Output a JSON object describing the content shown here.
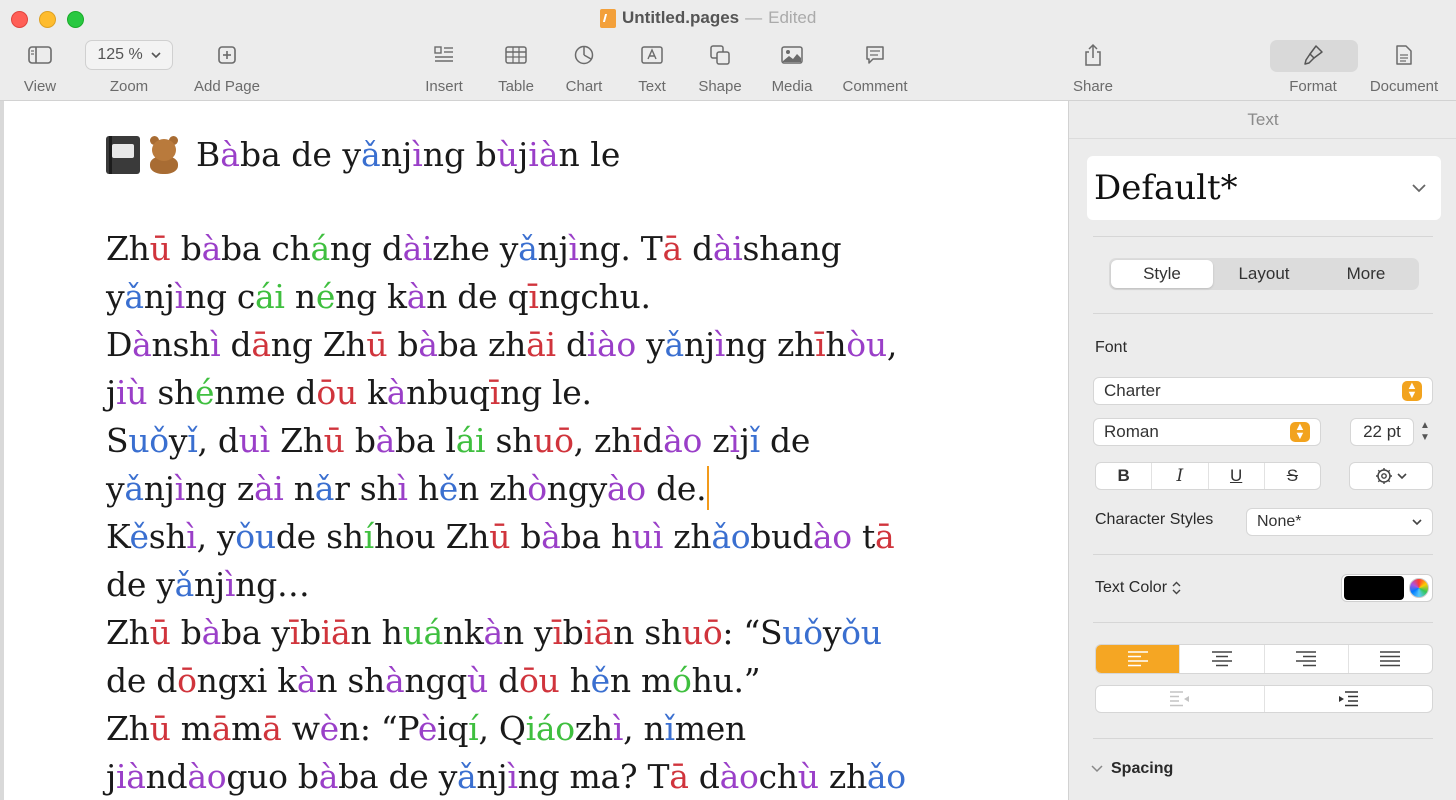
{
  "window": {
    "file_name": "Untitled.pages",
    "separator": "—",
    "status": "Edited"
  },
  "toolbar": {
    "view": "View",
    "zoom_value": "125 %",
    "zoom": "Zoom",
    "add_page": "Add Page",
    "insert": "Insert",
    "table": "Table",
    "chart": "Chart",
    "text": "Text",
    "shape": "Shape",
    "media": "Media",
    "comment": "Comment",
    "share": "Share",
    "format": "Format",
    "document": "Document"
  },
  "document": {
    "heading": [
      {
        "t": "B"
      },
      {
        "t": "à",
        "c": "p"
      },
      {
        "t": "ba de y"
      },
      {
        "t": "ǎ",
        "c": "b"
      },
      {
        "t": "nj"
      },
      {
        "t": "ì",
        "c": "p"
      },
      {
        "t": "ng b"
      },
      {
        "t": "ù",
        "c": "p"
      },
      {
        "t": "j"
      },
      {
        "t": "ià",
        "c": "p"
      },
      {
        "t": "n le"
      }
    ],
    "lines": [
      [
        {
          "t": "Zh"
        },
        {
          "t": "ū",
          "c": "r"
        },
        {
          "t": " b"
        },
        {
          "t": "à",
          "c": "p"
        },
        {
          "t": "ba ch"
        },
        {
          "t": "á",
          "c": "g"
        },
        {
          "t": "ng d"
        },
        {
          "t": "ài",
          "c": "p"
        },
        {
          "t": "zhe y"
        },
        {
          "t": "ǎ",
          "c": "b"
        },
        {
          "t": "nj"
        },
        {
          "t": "ì",
          "c": "p"
        },
        {
          "t": "ng. T"
        },
        {
          "t": "ā",
          "c": "r"
        },
        {
          "t": " d"
        },
        {
          "t": "ài",
          "c": "p"
        },
        {
          "t": "shang"
        }
      ],
      [
        {
          "t": "y"
        },
        {
          "t": "ǎ",
          "c": "b"
        },
        {
          "t": "nj"
        },
        {
          "t": "ì",
          "c": "p"
        },
        {
          "t": "ng c"
        },
        {
          "t": "ái",
          "c": "g"
        },
        {
          "t": " n"
        },
        {
          "t": "é",
          "c": "g"
        },
        {
          "t": "ng k"
        },
        {
          "t": "à",
          "c": "p"
        },
        {
          "t": "n de q"
        },
        {
          "t": "ī",
          "c": "r"
        },
        {
          "t": "ngchu."
        }
      ],
      [
        {
          "t": "D"
        },
        {
          "t": "à",
          "c": "p"
        },
        {
          "t": "nsh"
        },
        {
          "t": "ì",
          "c": "p"
        },
        {
          "t": " d"
        },
        {
          "t": "ā",
          "c": "r"
        },
        {
          "t": "ng Zh"
        },
        {
          "t": "ū",
          "c": "r"
        },
        {
          "t": " b"
        },
        {
          "t": "à",
          "c": "p"
        },
        {
          "t": "ba zh"
        },
        {
          "t": "āi",
          "c": "r"
        },
        {
          "t": " d"
        },
        {
          "t": "iào",
          "c": "p"
        },
        {
          "t": " y"
        },
        {
          "t": "ǎ",
          "c": "b"
        },
        {
          "t": "nj"
        },
        {
          "t": "ì",
          "c": "p"
        },
        {
          "t": "ng zh"
        },
        {
          "t": "ī",
          "c": "r"
        },
        {
          "t": "h"
        },
        {
          "t": "òu",
          "c": "p"
        },
        {
          "t": ","
        }
      ],
      [
        {
          "t": "j"
        },
        {
          "t": "iù",
          "c": "p"
        },
        {
          "t": " sh"
        },
        {
          "t": "é",
          "c": "g"
        },
        {
          "t": "nme d"
        },
        {
          "t": "ōu",
          "c": "r"
        },
        {
          "t": " k"
        },
        {
          "t": "à",
          "c": "p"
        },
        {
          "t": "nbuq"
        },
        {
          "t": "ī",
          "c": "r"
        },
        {
          "t": "ng le."
        }
      ],
      [
        {
          "t": "S"
        },
        {
          "t": "uǒ",
          "c": "b"
        },
        {
          "t": "y"
        },
        {
          "t": "ǐ",
          "c": "b"
        },
        {
          "t": ", d"
        },
        {
          "t": "uì",
          "c": "p"
        },
        {
          "t": " Zh"
        },
        {
          "t": "ū",
          "c": "r"
        },
        {
          "t": " b"
        },
        {
          "t": "à",
          "c": "p"
        },
        {
          "t": "ba l"
        },
        {
          "t": "ái",
          "c": "g"
        },
        {
          "t": " sh"
        },
        {
          "t": "uō",
          "c": "r"
        },
        {
          "t": ", zh"
        },
        {
          "t": "ī",
          "c": "r"
        },
        {
          "t": "d"
        },
        {
          "t": "ào",
          "c": "p"
        },
        {
          "t": " z"
        },
        {
          "t": "ì",
          "c": "p"
        },
        {
          "t": "j"
        },
        {
          "t": "ǐ",
          "c": "b"
        },
        {
          "t": " de"
        }
      ],
      [
        {
          "t": "y"
        },
        {
          "t": "ǎ",
          "c": "b"
        },
        {
          "t": "nj"
        },
        {
          "t": "ì",
          "c": "p"
        },
        {
          "t": "ng z"
        },
        {
          "t": "ài",
          "c": "p"
        },
        {
          "t": " n"
        },
        {
          "t": "ǎ",
          "c": "b"
        },
        {
          "t": "r sh"
        },
        {
          "t": "ì",
          "c": "p"
        },
        {
          "t": " h"
        },
        {
          "t": "ě",
          "c": "b"
        },
        {
          "t": "n zh"
        },
        {
          "t": "ò",
          "c": "p"
        },
        {
          "t": "ngy"
        },
        {
          "t": "ào",
          "c": "p"
        },
        {
          "t": " de."
        }
      ],
      [
        {
          "t": "K"
        },
        {
          "t": "ě",
          "c": "b"
        },
        {
          "t": "sh"
        },
        {
          "t": "ì",
          "c": "p"
        },
        {
          "t": ", y"
        },
        {
          "t": "ǒu",
          "c": "b"
        },
        {
          "t": "de sh"
        },
        {
          "t": "í",
          "c": "g"
        },
        {
          "t": "hou Zh"
        },
        {
          "t": "ū",
          "c": "r"
        },
        {
          "t": " b"
        },
        {
          "t": "à",
          "c": "p"
        },
        {
          "t": "ba h"
        },
        {
          "t": "uì",
          "c": "p"
        },
        {
          "t": " zh"
        },
        {
          "t": "ǎo",
          "c": "b"
        },
        {
          "t": "bud"
        },
        {
          "t": "ào",
          "c": "p"
        },
        {
          "t": " t"
        },
        {
          "t": "ā",
          "c": "r"
        }
      ],
      [
        {
          "t": "de y"
        },
        {
          "t": "ǎ",
          "c": "b"
        },
        {
          "t": "nj"
        },
        {
          "t": "ì",
          "c": "p"
        },
        {
          "t": "ng…"
        }
      ],
      [
        {
          "t": "Zh"
        },
        {
          "t": "ū",
          "c": "r"
        },
        {
          "t": " b"
        },
        {
          "t": "à",
          "c": "p"
        },
        {
          "t": "ba y"
        },
        {
          "t": "ī",
          "c": "r"
        },
        {
          "t": "b"
        },
        {
          "t": "iā",
          "c": "r"
        },
        {
          "t": "n h"
        },
        {
          "t": "uá",
          "c": "g"
        },
        {
          "t": "nk"
        },
        {
          "t": "à",
          "c": "p"
        },
        {
          "t": "n y"
        },
        {
          "t": "ī",
          "c": "r"
        },
        {
          "t": "b"
        },
        {
          "t": "iā",
          "c": "r"
        },
        {
          "t": "n sh"
        },
        {
          "t": "uō",
          "c": "r"
        },
        {
          "t": ": “S"
        },
        {
          "t": "uǒ",
          "c": "b"
        },
        {
          "t": "y"
        },
        {
          "t": "ǒu",
          "c": "b"
        }
      ],
      [
        {
          "t": "de d"
        },
        {
          "t": "ō",
          "c": "r"
        },
        {
          "t": "ngxi k"
        },
        {
          "t": "à",
          "c": "p"
        },
        {
          "t": "n sh"
        },
        {
          "t": "à",
          "c": "p"
        },
        {
          "t": "ngq"
        },
        {
          "t": "ù",
          "c": "p"
        },
        {
          "t": " d"
        },
        {
          "t": "ōu",
          "c": "r"
        },
        {
          "t": " h"
        },
        {
          "t": "ě",
          "c": "b"
        },
        {
          "t": "n m"
        },
        {
          "t": "ó",
          "c": "g"
        },
        {
          "t": "hu.”"
        }
      ],
      [
        {
          "t": "Zh"
        },
        {
          "t": "ū",
          "c": "r"
        },
        {
          "t": " m"
        },
        {
          "t": "ā",
          "c": "r"
        },
        {
          "t": "m"
        },
        {
          "t": "ā",
          "c": "r"
        },
        {
          "t": " w"
        },
        {
          "t": "è",
          "c": "p"
        },
        {
          "t": "n: “P"
        },
        {
          "t": "è",
          "c": "p"
        },
        {
          "t": "iq"
        },
        {
          "t": "í",
          "c": "g"
        },
        {
          "t": ", Q"
        },
        {
          "t": "iáo",
          "c": "g"
        },
        {
          "t": "zh"
        },
        {
          "t": "ì",
          "c": "p"
        },
        {
          "t": ", n"
        },
        {
          "t": "ǐ",
          "c": "b"
        },
        {
          "t": "men"
        }
      ],
      [
        {
          "t": "j"
        },
        {
          "t": "ià",
          "c": "p"
        },
        {
          "t": "nd"
        },
        {
          "t": "ào",
          "c": "p"
        },
        {
          "t": "guo b"
        },
        {
          "t": "à",
          "c": "p"
        },
        {
          "t": "ba de y"
        },
        {
          "t": "ǎ",
          "c": "b"
        },
        {
          "t": "nj"
        },
        {
          "t": "ì",
          "c": "p"
        },
        {
          "t": "ng ma? T"
        },
        {
          "t": "ā",
          "c": "r"
        },
        {
          "t": " d"
        },
        {
          "t": "ào",
          "c": "p"
        },
        {
          "t": "ch"
        },
        {
          "t": "ù",
          "c": "p"
        },
        {
          "t": " zh"
        },
        {
          "t": "ǎo",
          "c": "b"
        }
      ]
    ]
  },
  "sidebar": {
    "header": "Text",
    "paragraph_style": "Default*",
    "tabs": [
      "Style",
      "Layout",
      "More"
    ],
    "font_label": "Font",
    "font_family": "Charter",
    "font_typeface": "Roman",
    "font_size": "22 pt",
    "bold": "B",
    "italic": "I",
    "underline": "U",
    "strike": "S",
    "character_styles_label": "Character Styles",
    "character_style": "None*",
    "text_color_label": "Text Color",
    "text_color": "#000000",
    "spacing_label": "Spacing"
  },
  "colors": {
    "accent": "#f5a623",
    "tone_1": "#d0343c",
    "tone_2": "#3fbf3f",
    "tone_3": "#3a6fd0",
    "tone_4": "#9a3fc8"
  }
}
